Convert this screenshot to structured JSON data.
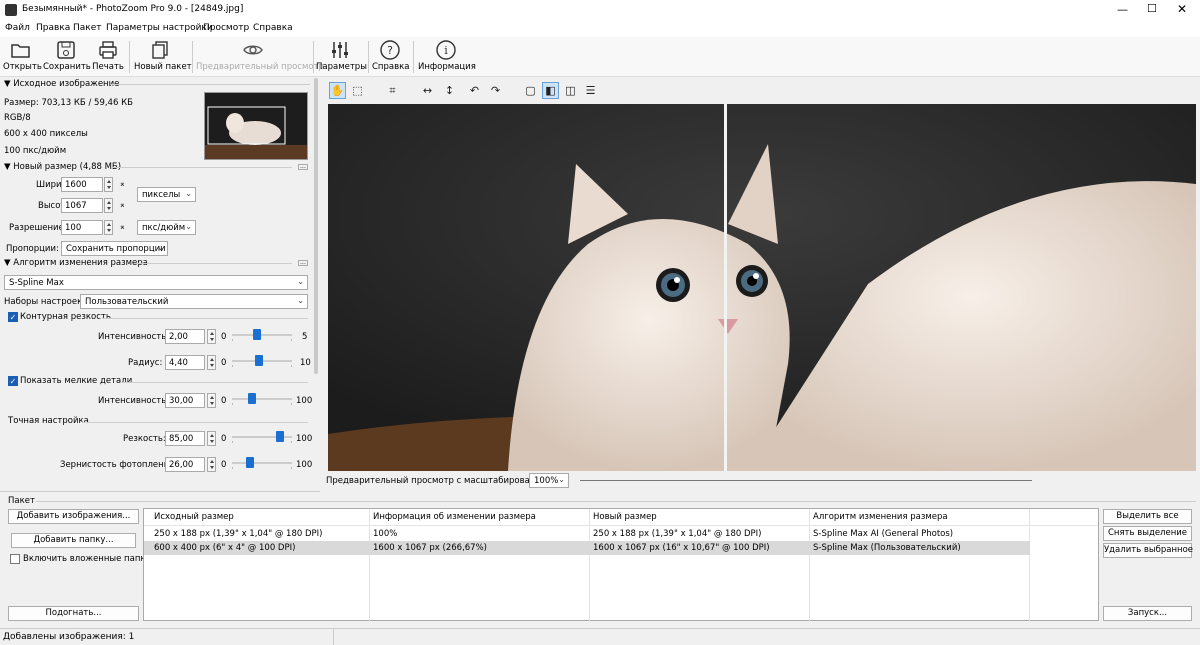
{
  "window": {
    "title": "Безымянный* - PhotoZoom Pro 9.0 - [24849.jpg]"
  },
  "menu": [
    "Файл",
    "Правка",
    "Пакет",
    "Параметры настройки",
    "Просмотр",
    "Справка"
  ],
  "toolbar": [
    {
      "label": "Открыть",
      "icon": "folder-open-icon"
    },
    {
      "label": "Сохранить",
      "icon": "save-icon"
    },
    {
      "label": "Печать",
      "icon": "printer-icon"
    },
    {
      "label": "Новый пакет",
      "icon": "batch-icon"
    },
    {
      "label": "Предварительный просмотр",
      "icon": "eye-icon",
      "disabled": true
    },
    {
      "label": "Параметры",
      "icon": "sliders-icon"
    },
    {
      "label": "Справка",
      "icon": "help-icon"
    },
    {
      "label": "Информация",
      "icon": "info-icon"
    }
  ],
  "source": {
    "header": "Исходное изображение",
    "size": "Размер: 703,13 КБ / 59,46 КБ",
    "mode": "RGB/8",
    "dims": "600 x 400 пикселы",
    "res": "100 пкс/дюйм"
  },
  "newsize": {
    "header": "Новый размер (4,88 МБ)",
    "width_label": "Ширина:",
    "width": "1600",
    "height_label": "Высота:",
    "height": "1067",
    "res_label": "Разрешение:",
    "res": "100",
    "unit": "пикселы",
    "res_unit": "пкс/дюйм",
    "prop_label": "Пропорции:",
    "prop": "Сохранить пропорции"
  },
  "algo": {
    "header": "Алгоритм изменения размера",
    "method": "S-Spline Max",
    "presets_label": "Наборы настроек:",
    "preset": "Пользовательский",
    "edge_sharp": "Контурная резкость",
    "intensity_label": "Интенсивность:",
    "intensity": "2,00",
    "intensity_min": "0",
    "intensity_max": "5",
    "intensity_level": 0.4,
    "radius_label": "Радиус:",
    "radius": "4,40",
    "radius_min": "0",
    "radius_max": "10",
    "radius_level": 0.44,
    "fine_details": "Показать мелкие детали",
    "fd_intensity_label": "Интенсивность:",
    "fd_intensity": "30,00",
    "fd_min": "0",
    "fd_max": "100",
    "fd_level": 0.3,
    "fine_tune": "Точная настройка",
    "sharp_label": "Резкость:",
    "sharp": "85,00",
    "sharp_min": "0",
    "sharp_max": "100",
    "sharp_level": 0.85,
    "grain_label": "Зернистость фотопленки:",
    "grain": "26,00",
    "grain_min": "0",
    "grain_max": "100",
    "grain_level": 0.26
  },
  "preview": {
    "zoom_label": "Предварительный просмотр с масштабированием:",
    "zoom": "100%"
  },
  "batch": {
    "header": "Пакет",
    "add_images": "Добавить изображения...",
    "add_folder": "Добавить папку...",
    "include_sub": "Включить вложенные папки",
    "fit": "Подогнать...",
    "select_all": "Выделить все",
    "deselect": "Снять выделение",
    "remove": "Удалить выбранное",
    "run": "Запуск...",
    "columns": [
      "Исходный размер",
      "Информация об изменении размера",
      "Новый размер",
      "Алгоритм изменения размера"
    ],
    "rows": [
      [
        "250 x 188 px (1,39\" x 1,04\" @ 180 DPI)",
        "100%",
        "250 x 188 px (1,39\" x 1,04\" @ 180 DPI)",
        "S-Spline Max AI (General Photos)"
      ],
      [
        "600 x 400 px (6\" x 4\" @ 100 DPI)",
        "1600 x 1067 px (266,67%)",
        "1600 x 1067 px (16\" x 10,67\" @ 100 DPI)",
        "S-Spline Max (Пользовательский)"
      ]
    ]
  },
  "status": "Добавлены изображения: 1"
}
